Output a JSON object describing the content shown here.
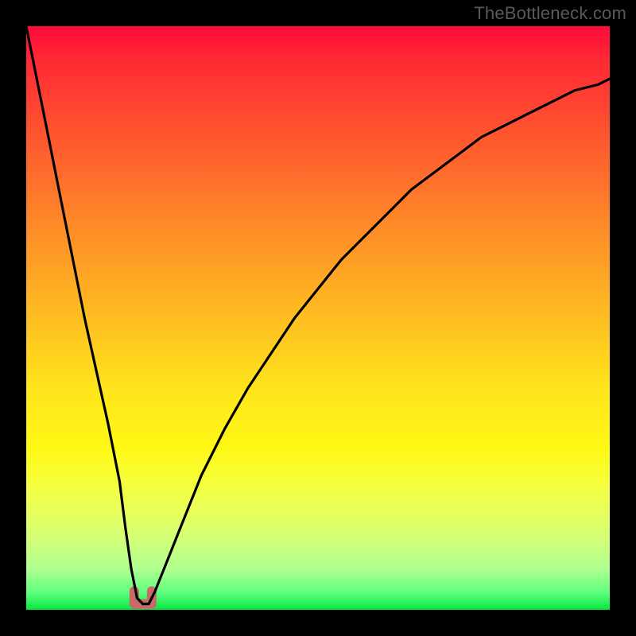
{
  "watermark": "TheBottleneck.com",
  "chart_data": {
    "type": "line",
    "title": "",
    "xlabel": "",
    "ylabel": "",
    "xlim": [
      0,
      100
    ],
    "ylim": [
      0,
      100
    ],
    "grid": false,
    "legend": false,
    "x": [
      0,
      2,
      4,
      6,
      8,
      10,
      12,
      14,
      16,
      17,
      18,
      19,
      20,
      21,
      22,
      24,
      26,
      28,
      30,
      34,
      38,
      42,
      46,
      50,
      54,
      58,
      62,
      66,
      70,
      74,
      78,
      82,
      86,
      90,
      94,
      98,
      100
    ],
    "series": [
      {
        "name": "bottleneck-curve",
        "values": [
          100,
          90,
          80,
          70,
          60,
          50,
          41,
          32,
          22,
          14,
          7,
          2,
          1,
          1,
          3,
          8,
          13,
          18,
          23,
          31,
          38,
          44,
          50,
          55,
          60,
          64,
          68,
          72,
          75,
          78,
          81,
          83,
          85,
          87,
          89,
          90,
          91
        ]
      }
    ],
    "marker": {
      "name": "optimal-region",
      "x_center": 20,
      "y": 1,
      "width": 3,
      "color": "#c96a6a"
    },
    "gradient_stops": [
      {
        "pos": 0,
        "color": "#ff0a3a"
      },
      {
        "pos": 20,
        "color": "#ff5a2e"
      },
      {
        "pos": 48,
        "color": "#ffb822"
      },
      {
        "pos": 72,
        "color": "#fff814"
      },
      {
        "pos": 88,
        "color": "#d2ff78"
      },
      {
        "pos": 100,
        "color": "#06e840"
      }
    ]
  }
}
